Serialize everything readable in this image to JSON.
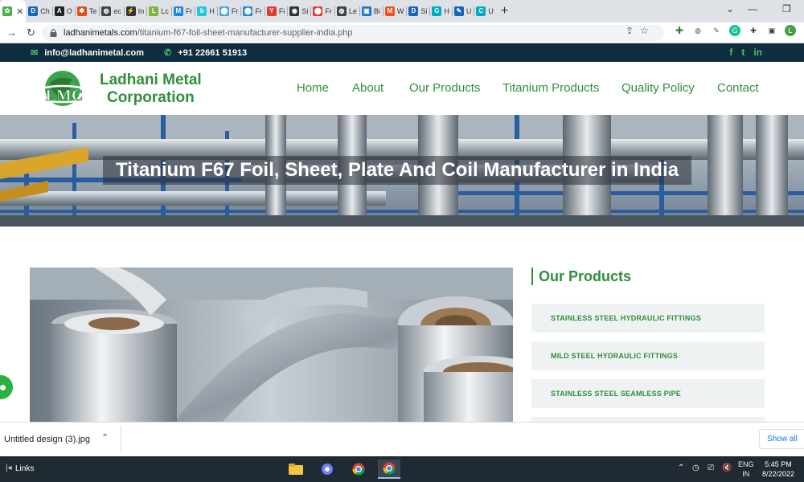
{
  "browser": {
    "tabs": [
      {
        "label": "",
        "color": "#4caf50",
        "glyph": "✿",
        "active": true
      },
      {
        "label": "Ch",
        "color": "#1565c0",
        "glyph": "D"
      },
      {
        "label": "O",
        "color": "#222222",
        "glyph": "A"
      },
      {
        "label": "Te",
        "color": "#e64a19",
        "glyph": "✽"
      },
      {
        "label": "ec",
        "color": "#444444",
        "glyph": "◍"
      },
      {
        "label": "In",
        "color": "#333333",
        "glyph": "⚡"
      },
      {
        "label": "Lc",
        "color": "#7cb342",
        "glyph": "L"
      },
      {
        "label": "Fr",
        "color": "#1e88e5",
        "glyph": "M"
      },
      {
        "label": "H",
        "color": "#26c6da",
        "glyph": "b"
      },
      {
        "label": "Fr",
        "color": "#42a5f5",
        "glyph": "⬤"
      },
      {
        "label": "Fr",
        "color": "#1e88e5",
        "glyph": "⬤"
      },
      {
        "label": "Fi",
        "color": "#e53935",
        "glyph": "Y"
      },
      {
        "label": "Si",
        "color": "#333333",
        "glyph": "◉"
      },
      {
        "label": "Fr",
        "color": "#e53935",
        "glyph": "⬤"
      },
      {
        "label": "Le",
        "color": "#444444",
        "glyph": "◍"
      },
      {
        "label": "Bi",
        "color": "#1976d2",
        "glyph": "▣"
      },
      {
        "label": "W",
        "color": "#f4511e",
        "glyph": "M"
      },
      {
        "label": "Si",
        "color": "#1565c0",
        "glyph": "D"
      },
      {
        "label": "H",
        "color": "#00acc1",
        "glyph": "G"
      },
      {
        "label": "U",
        "color": "#1565c0",
        "glyph": "✎"
      },
      {
        "label": "U",
        "color": "#00acc1",
        "glyph": "C"
      }
    ],
    "url_host": "ladhanimetals.com",
    "url_path": "/titanium-f67-foil-sheet-manufacturer-supplier-india.php",
    "profile_initial": "L"
  },
  "topbar": {
    "email": "info@ladhanimetal.com",
    "phone": "+91 22661 51913",
    "social": [
      "f",
      "t",
      "in"
    ]
  },
  "header": {
    "brand_line1": "Ladhani Metal",
    "brand_line2": "Corporation",
    "nav": [
      "Home",
      "About",
      "Our Products",
      "Titanium Products",
      "Quality Policy",
      "Contact"
    ]
  },
  "hero": {
    "title": "Titanium F67 Foil, Sheet, Plate And Coil Manufacturer in India"
  },
  "sidebar": {
    "title": "Our Products",
    "items": [
      "STAINLESS STEEL HYDRAULIC FITTINGS",
      "MILD STEEL HYDRAULIC FITTINGS",
      "STAINLESS STEEL SEAMLESS PIPE"
    ]
  },
  "downloads": {
    "file": "Untitled design (3).jpg",
    "show_all": "Show all"
  },
  "taskbar": {
    "links": "Links",
    "lang1": "ENG",
    "lang2": "IN",
    "time": "5:45 PM",
    "date": "8/22/2022"
  },
  "colors": {
    "brand_green": "#2f8e3b",
    "topbar_bg": "#0e2d3f",
    "accent_green": "#4ec06a"
  }
}
